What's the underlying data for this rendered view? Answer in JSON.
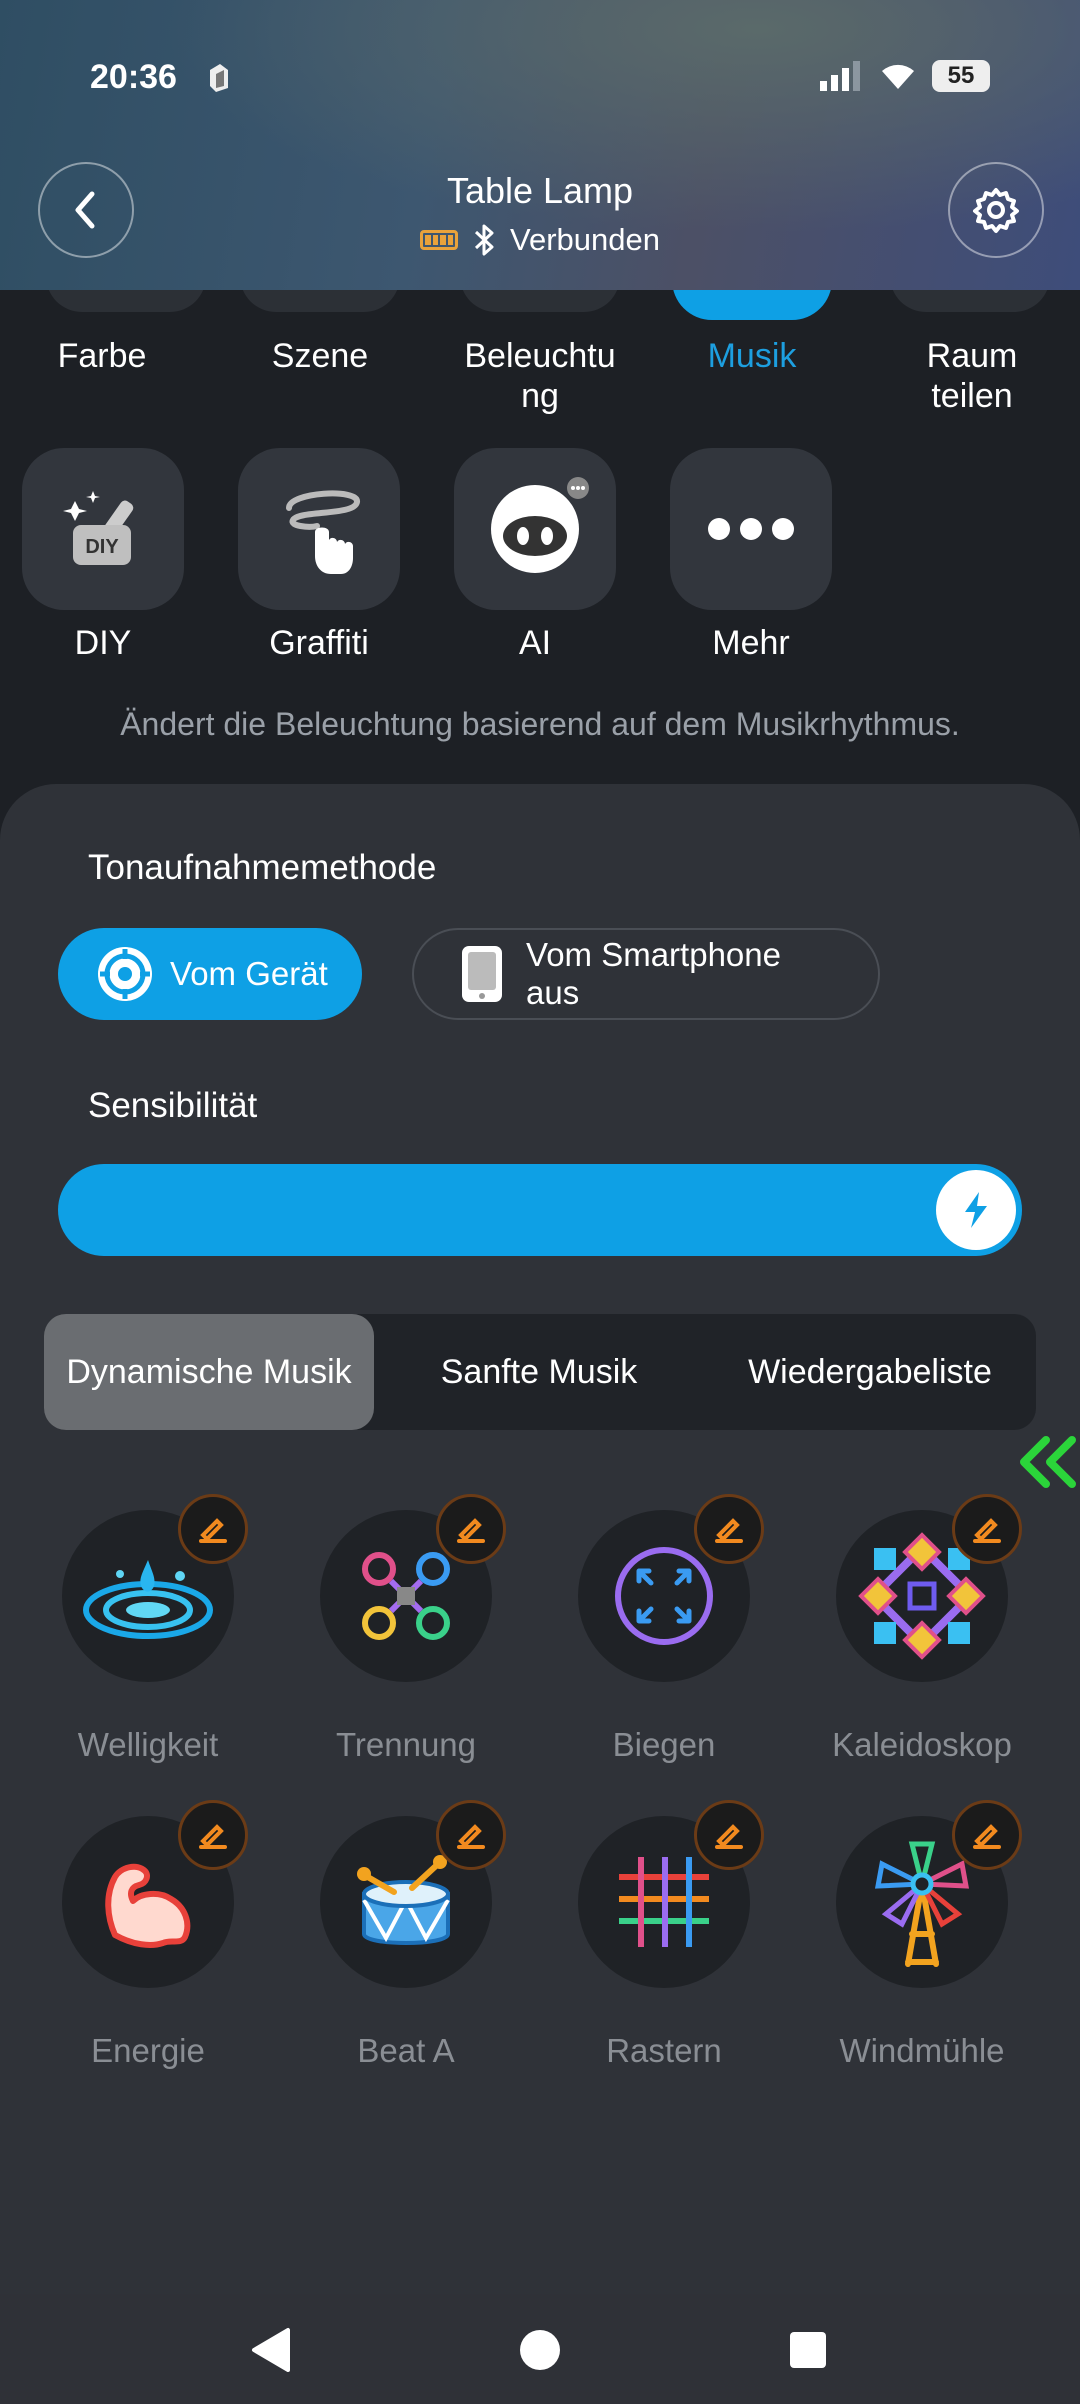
{
  "status_bar": {
    "time": "20:36",
    "battery": "55"
  },
  "header": {
    "title": "Table Lamp",
    "connection": "Verbunden"
  },
  "category_tabs": [
    {
      "label": "Farbe"
    },
    {
      "label": "Szene"
    },
    {
      "label": "Beleuchtu ng"
    },
    {
      "label": "Musik"
    },
    {
      "label": "Raum teilen"
    }
  ],
  "mode_buttons": [
    {
      "label": "DIY"
    },
    {
      "label": "Graffiti"
    },
    {
      "label": "AI"
    },
    {
      "label": "Mehr"
    }
  ],
  "description": "Ändert die Beleuchtung basierend auf dem Musikrhythmus.",
  "recording": {
    "label": "Tonaufnahmemethode",
    "options": [
      "Vom Gerät",
      "Vom Smartphone aus"
    ],
    "selected": "Vom Gerät"
  },
  "sensitivity": {
    "label": "Sensibilität",
    "level_percent": 100
  },
  "segment_tabs": [
    "Dynamische Musik",
    "Sanfte Musik",
    "Wiedergabeliste"
  ],
  "effects": [
    {
      "label": "Welligkeit"
    },
    {
      "label": "Trennung"
    },
    {
      "label": "Biegen"
    },
    {
      "label": "Kaleidoskop"
    },
    {
      "label": "Energie"
    },
    {
      "label": "Beat A"
    },
    {
      "label": "Rastern"
    },
    {
      "label": "Windmühle"
    }
  ],
  "colors": {
    "accent": "#0ea0e5",
    "panel": "#2f3238",
    "background": "#1d2025"
  }
}
